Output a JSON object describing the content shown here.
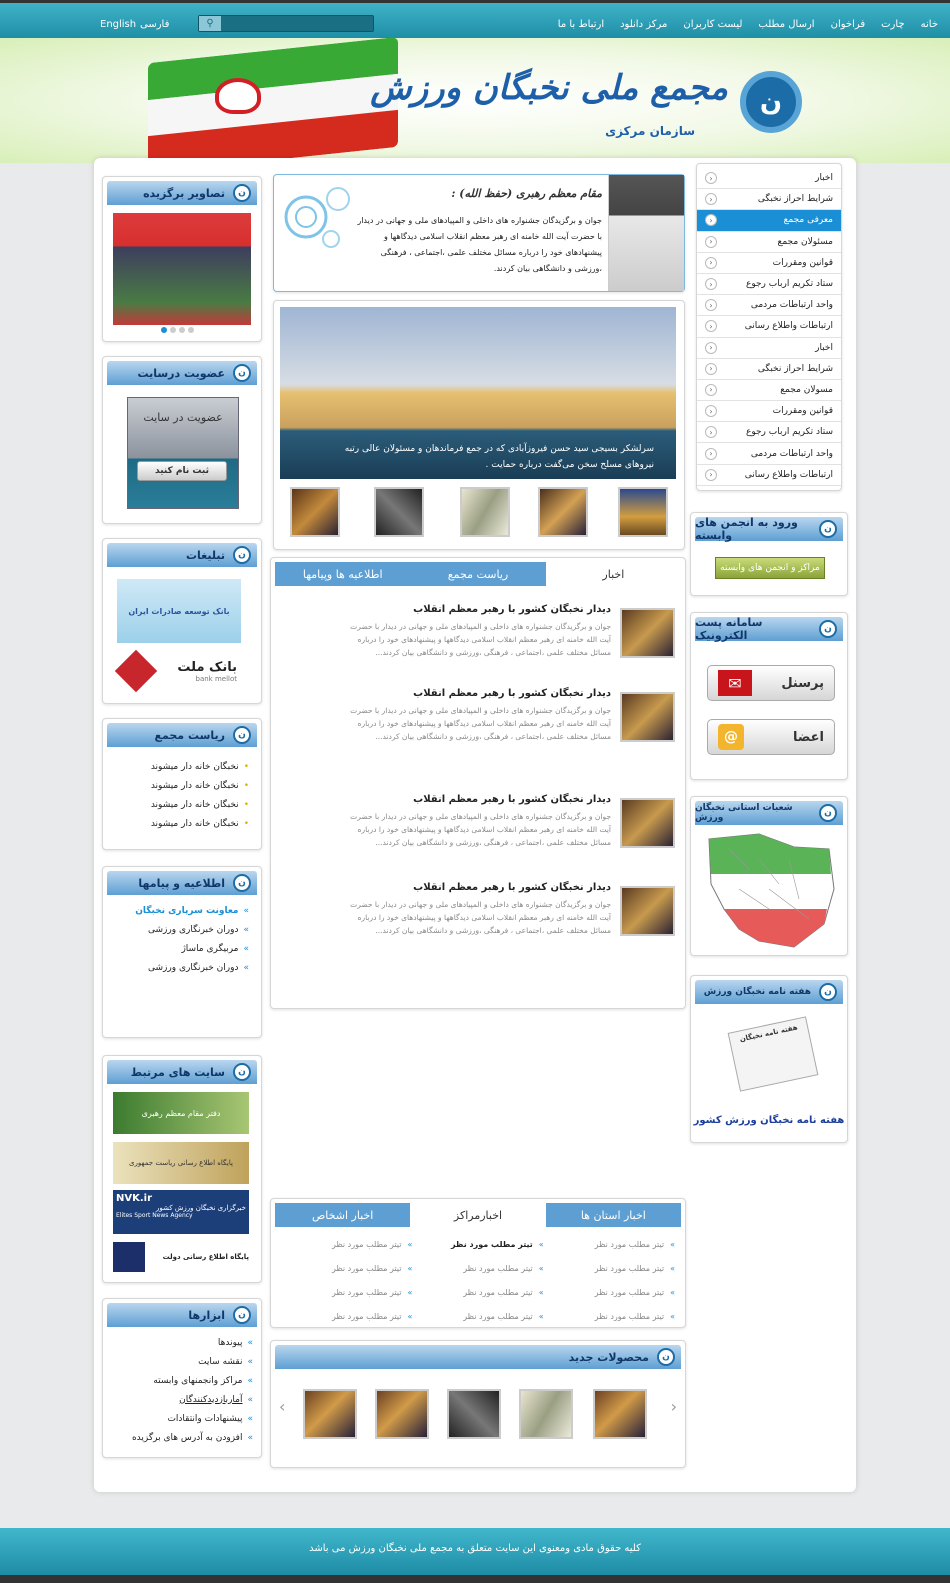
{
  "topnav": [
    "خانه",
    "چارت",
    "فراخوان",
    "ارسال مطلب",
    "لیست کاربران",
    "مرکز دانلود",
    "ارتباط با ما"
  ],
  "lang": {
    "fa": "فارسی",
    "en": "English"
  },
  "logo": {
    "mark": "ن",
    "title": "مجمع ملی نخبگان ورزش",
    "subtitle": "سازمان مرکزی"
  },
  "rightmenu": [
    "اخبار",
    "شرایط احراز نخبگی",
    "معرفی مجمع",
    "مسئولان مجمع",
    "قوانین ومقررات",
    "ستاد تکریم ارباب رجوع",
    "واحد ارتباطات مردمی",
    "ارتباطات واطلاع رسانی",
    "اخبار",
    "شرایط احراز نخبگی",
    "مسولان مجمع",
    "قوانین ومقررات",
    "ستاد تکریم ارباب رجوع",
    "واحد ارتباطات مردمی",
    "ارتباطات واطلاع رسانی"
  ],
  "assoc": {
    "title": "ورود به انجمن های وابسته",
    "button": "مراکز و انجمن های وابسته"
  },
  "email": {
    "title": "سامانه پست الکترونیک",
    "personnel": "پرسنل",
    "members": "اعضا"
  },
  "provinces": {
    "title": "شعبات استانی نخبگان ورزش"
  },
  "weekly": {
    "title": "هفته نامه نخبگان ورزش",
    "caption": "هفته نامه نخبگان ورزش کشور",
    "paper": "هفته نامه نخبگان"
  },
  "leader": {
    "title": "مقام معظم رهبری (حفظ الله) :",
    "text": "جوان و برگزیدگان جشنواره های داخلی و المپیادهای ملی و جهانی در دیدار با حضرت آیت الله خامنه ای رهبر معظم انقلاب اسلامی دیدگاهها و پیشنهادهای خود را درباره مسائل مختلف علمی ،اجتماعی ، فرهنگی ،ورزشی و دانشگاهی بیان کردند."
  },
  "slider": {
    "caption": "سرلشکر بسیجی سید حسن فیروزآبادی که در جمع فرماندهان و مسئولان عالی رتبه نیروهای مسلح سخن می‌گفت درباره حمایت ."
  },
  "newstabs": [
    "اخبار",
    "ریاست مجمع",
    "اطلاعیه ها وپیامها"
  ],
  "news": [
    {
      "title": "دیدار نخبگان کشور با رهبر معظم انقلاب",
      "desc": "جوان و برگزیدگان جشنواره های داخلی و المپیادهای ملی و جهانی در دیدار با حضرت آیت الله خامنه ای رهبر معظم انقلاب اسلامی دیدگاهها و پیشنهادهای خود را درباره مسائل مختلف علمی ،اجتماعی ، فرهنگی ،ورزشی و دانشگاهی بیان کردند..."
    },
    {
      "title": "دیدار نخبگان کشور با رهبر معظم انقلاب",
      "desc": "جوان و برگزیدگان جشنواره های داخلی و المپیادهای ملی و جهانی در دیدار با حضرت آیت الله خامنه ای رهبر معظم انقلاب اسلامی دیدگاهها و پیشنهادهای خود را درباره مسائل مختلف علمی ،اجتماعی ، فرهنگی ،ورزشی و دانشگاهی بیان کردند..."
    },
    {
      "title": "دیدار نخبگان کشور با رهبر معظم انقلاب",
      "desc": "جوان و برگزیدگان جشنواره های داخلی و المپیادهای ملی و جهانی در دیدار با حضرت آیت الله خامنه ای رهبر معظم انقلاب اسلامی دیدگاهها و پیشنهادهای خود را درباره مسائل مختلف علمی ،اجتماعی ، فرهنگی ،ورزشی و دانشگاهی بیان کردند..."
    },
    {
      "title": "دیدار نخبگان کشور با رهبر معظم انقلاب",
      "desc": "جوان و برگزیدگان جشنواره های داخلی و المپیادهای ملی و جهانی در دیدار با حضرت آیت الله خامنه ای رهبر معظم انقلاب اسلامی دیدگاهها و پیشنهادهای خود را درباره مسائل مختلف علمی ،اجتماعی ، فرهنگی ،ورزشی و دانشگاهی بیان کردند..."
    }
  ],
  "bottomtabs": [
    "اخبار استان ها",
    "اخبارمراکز",
    "اخبار اشخاص"
  ],
  "headline": "تیتر مطلب مورد نظر",
  "headline_bold": "تیتر مطلب مورد نظر",
  "products": {
    "title": "محصولات جدید"
  },
  "featured": {
    "title": "تصاویر برگزیده"
  },
  "membership": {
    "title": "عضویت درسایت",
    "heading": "عضویت در سایت",
    "button": "ثبت نام کنید"
  },
  "ads": {
    "title": "تبلیغات",
    "ad1": "بانک توسعه صادرات ایران",
    "ad2": "بانک ملت",
    "ad2en": "bank mellot"
  },
  "presidency": {
    "title": "ریاست مجمع",
    "items": [
      "نخبگان خانه دار میشوند",
      "نخبگان خانه دار میشوند",
      "نخبگان خانه دار میشوند",
      "نخبگان خانه دار میشوند"
    ]
  },
  "notices": {
    "title": "اطلاعیه و پیامها",
    "items": [
      "معاونت سرپاری نخبگان",
      "دوران خبرنگاری ورزشی",
      "مربیگری ماساژ",
      "دوران خبرنگاری ورزشی"
    ]
  },
  "related": {
    "title": "سایت های مرتبط",
    "s1": "دفتر مقام معظم رهبری",
    "s2": "پایگاه اطلاع رسانی ریاست جمهوری",
    "s3": "NVK.ir",
    "s3sub": "Elites Sport News Agency",
    "s3fa": "خبرگزاری نخبگان ورزش کشور",
    "s4": "پایگاه اطلاع رسانی دولت"
  },
  "tools": {
    "title": "ابزارها",
    "items": [
      "پیوندها",
      "نقشه سایت",
      "مراکز وانجمنهای وابسته",
      "آماربازدیدکنندگان",
      "پیشنهادات وانتقادات",
      "افزودن به آدرس های برگزیده"
    ]
  },
  "footer": "کلیه حقوق مادی ومعنوی این سایت متعلق به مجمع ملی نخبگان ورزش می باشد",
  "colors": {
    "topbar": "#1f8ea6",
    "header": "#5e9fd3",
    "accent": "#1b8fd6"
  }
}
